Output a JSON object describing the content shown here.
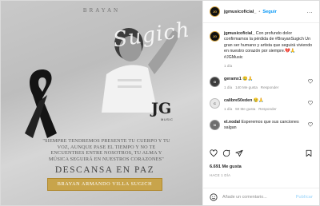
{
  "image": {
    "top_text": "BRAYAN",
    "signature": "Sugich",
    "logo_text": "JG",
    "logo_sub": "MUSIC",
    "quote": "\"SIEMPRE TENDREMOS PRESENTE TU CUERPO Y TU VOZ, AUNQUE PASE EL TIEMPO Y NO TE ENCUENTRES ENTRE NOSOTROS, TU ALMA Y MÚSICA SEGUIRÁ EN NUESTROS CORAZONES\"",
    "rip": "DESCANSA EN PAZ",
    "name": "BRAYAN ARMANDO VILLA SUGICH"
  },
  "header": {
    "username": "jgmusicoficial_",
    "separator": "•",
    "follow": "Seguir",
    "more": "..."
  },
  "caption": {
    "username": "jgmusicoficial_",
    "text": " Con profundo dolor confirmamos la pérdida de #BrayanSugich Un gran ser humano y artista que seguirá viviendo en nuestro corazón por siempre.💔🙏 #JGMusic",
    "time": "1 día"
  },
  "comments": [
    {
      "username": "geramx1",
      "text": " 😢🙏",
      "time": "1 día",
      "likes": "140 Me gusta",
      "reply": "Responder"
    },
    {
      "username": "calibre50eden",
      "text": " 😢🙏",
      "time": "1 día",
      "likes": "50 Me gusta",
      "reply": "Responder"
    },
    {
      "username": "el.nodal",
      "text": " Esperemos que sus canciones salgan",
      "time": "",
      "likes": "",
      "reply": ""
    }
  ],
  "likes": "6.691 Me gusta",
  "date": "HACE 1 DÍA",
  "add_comment": {
    "placeholder": "Añade un comentario...",
    "publish": "Publicar"
  },
  "colors": {
    "accent": "#0095f6",
    "gold": "#c8a44b",
    "muted": "#8e8e8e"
  }
}
